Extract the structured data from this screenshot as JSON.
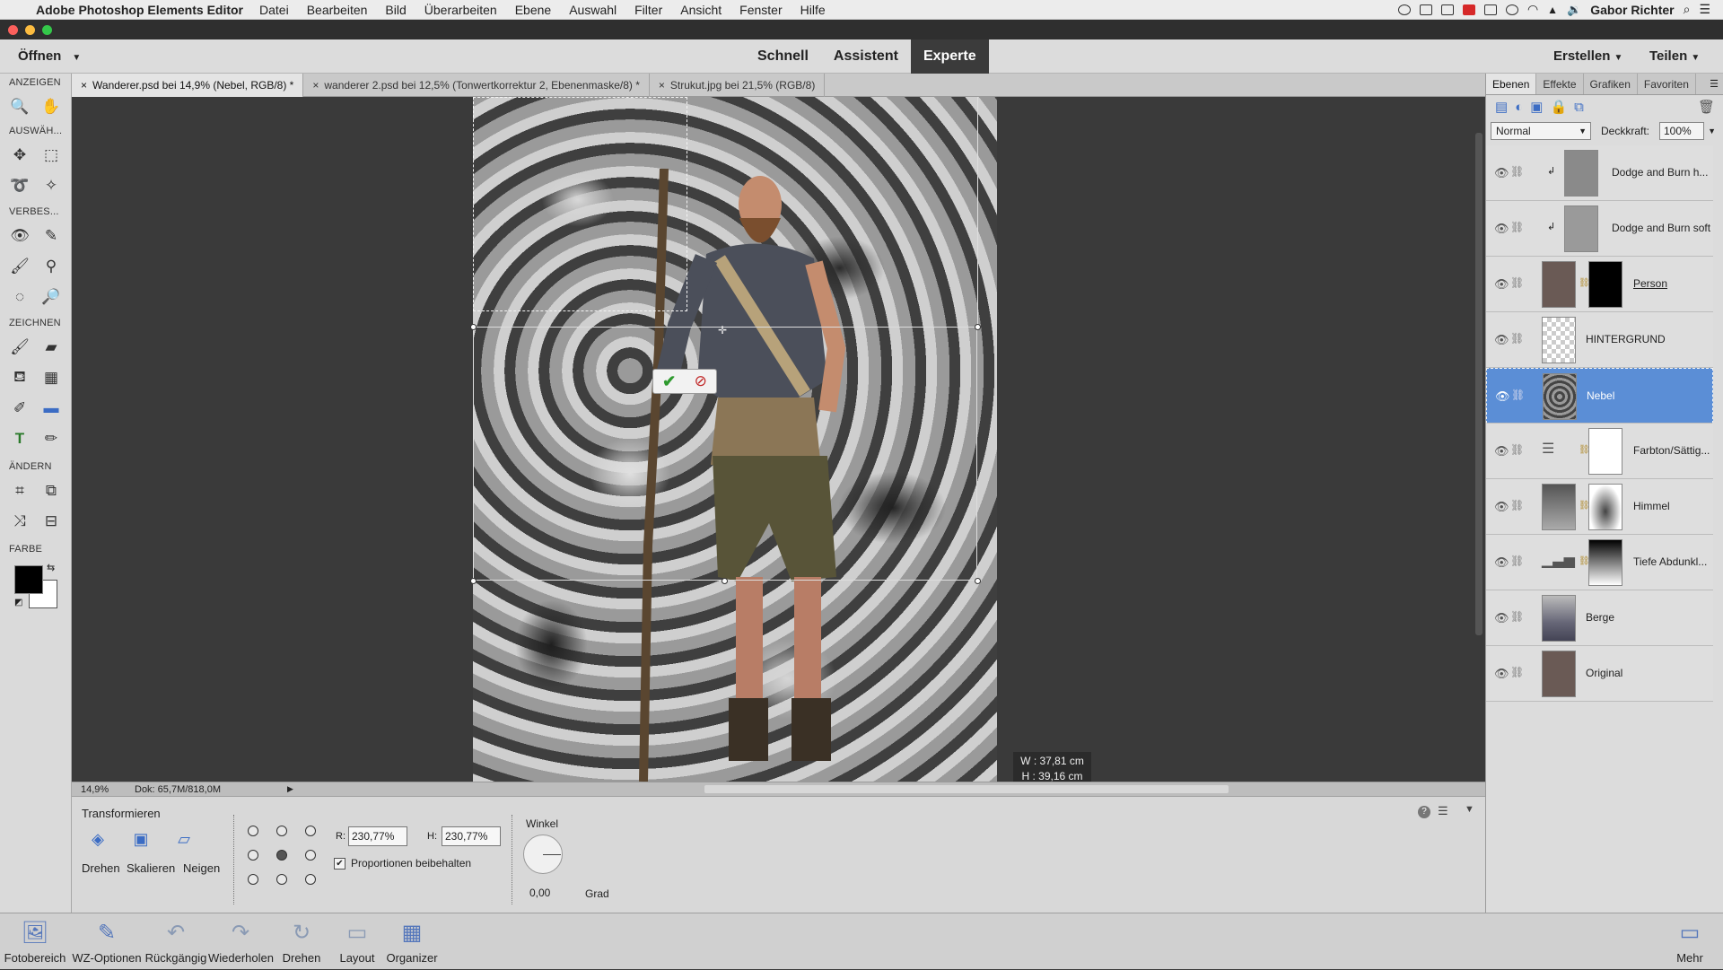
{
  "menubar": {
    "app": "Adobe Photoshop Elements Editor",
    "items": [
      "Datei",
      "Bearbeiten",
      "Bild",
      "Überarbeiten",
      "Ebene",
      "Auswahl",
      "Filter",
      "Ansicht",
      "Fenster",
      "Hilfe"
    ],
    "user": "Gabor Richter"
  },
  "modebar": {
    "open_label": "Öffnen",
    "modes": [
      "Schnell",
      "Assistent",
      "Experte"
    ],
    "active_mode": "Experte",
    "create_label": "Erstellen",
    "share_label": "Teilen"
  },
  "toolbox": {
    "sections": [
      "ANZEIGEN",
      "AUSWÄH...",
      "VERBES...",
      "ZEICHNEN",
      "ÄNDERN",
      "FARBE"
    ]
  },
  "doc_tabs": [
    {
      "label": "Wanderer.psd bei 14,9% (Nebel, RGB/8) *",
      "active": true
    },
    {
      "label": "wanderer 2.psd bei 12,5% (Tonwertkorrektur 2, Ebenenmaske/8) *",
      "active": false
    },
    {
      "label": "Strukut.jpg bei 21,5% (RGB/8)",
      "active": false
    }
  ],
  "canvas": {
    "size_tip_w": "W : 37,81 cm",
    "size_tip_h": "H : 39,16 cm"
  },
  "status": {
    "zoom": "14,9%",
    "doc": "Dok: 65,7M/818,0M"
  },
  "options": {
    "title": "Transformieren",
    "modes": [
      "Drehen",
      "Skalieren",
      "Neigen"
    ],
    "r_label": "R:",
    "r_value": "230,77%",
    "h_label": "H:",
    "h_value": "230,77%",
    "constrain_label": "Proportionen beibehalten",
    "angle_label": "Winkel",
    "angle_value": "0,00",
    "angle_unit": "Grad"
  },
  "bottombar": {
    "items": [
      "Fotobereich",
      "WZ-Optionen",
      "Rückgängig",
      "Wiederholen",
      "Drehen",
      "Layout",
      "Organizer"
    ],
    "more": "Mehr"
  },
  "rpanel": {
    "tabs": [
      "Ebenen",
      "Effekte",
      "Grafiken",
      "Favoriten"
    ],
    "blend_mode": "Normal",
    "opacity_label": "Deckkraft:",
    "opacity_value": "100%",
    "layers": [
      {
        "name": "Dodge and Burn h...",
        "selected": false
      },
      {
        "name": "Dodge and Burn soft",
        "selected": false
      },
      {
        "name": "Person",
        "selected": false
      },
      {
        "name": "HINTERGRUND",
        "selected": false
      },
      {
        "name": "Nebel",
        "selected": true
      },
      {
        "name": "Farbton/Sättig...",
        "selected": false
      },
      {
        "name": "Himmel",
        "selected": false
      },
      {
        "name": "Tiefe Abdunkl...",
        "selected": false
      },
      {
        "name": "Berge",
        "selected": false
      },
      {
        "name": "Original",
        "selected": false
      }
    ]
  },
  "colors": {
    "accent": "#5b8ed6",
    "active_mode_bg": "#3b3b3b"
  }
}
